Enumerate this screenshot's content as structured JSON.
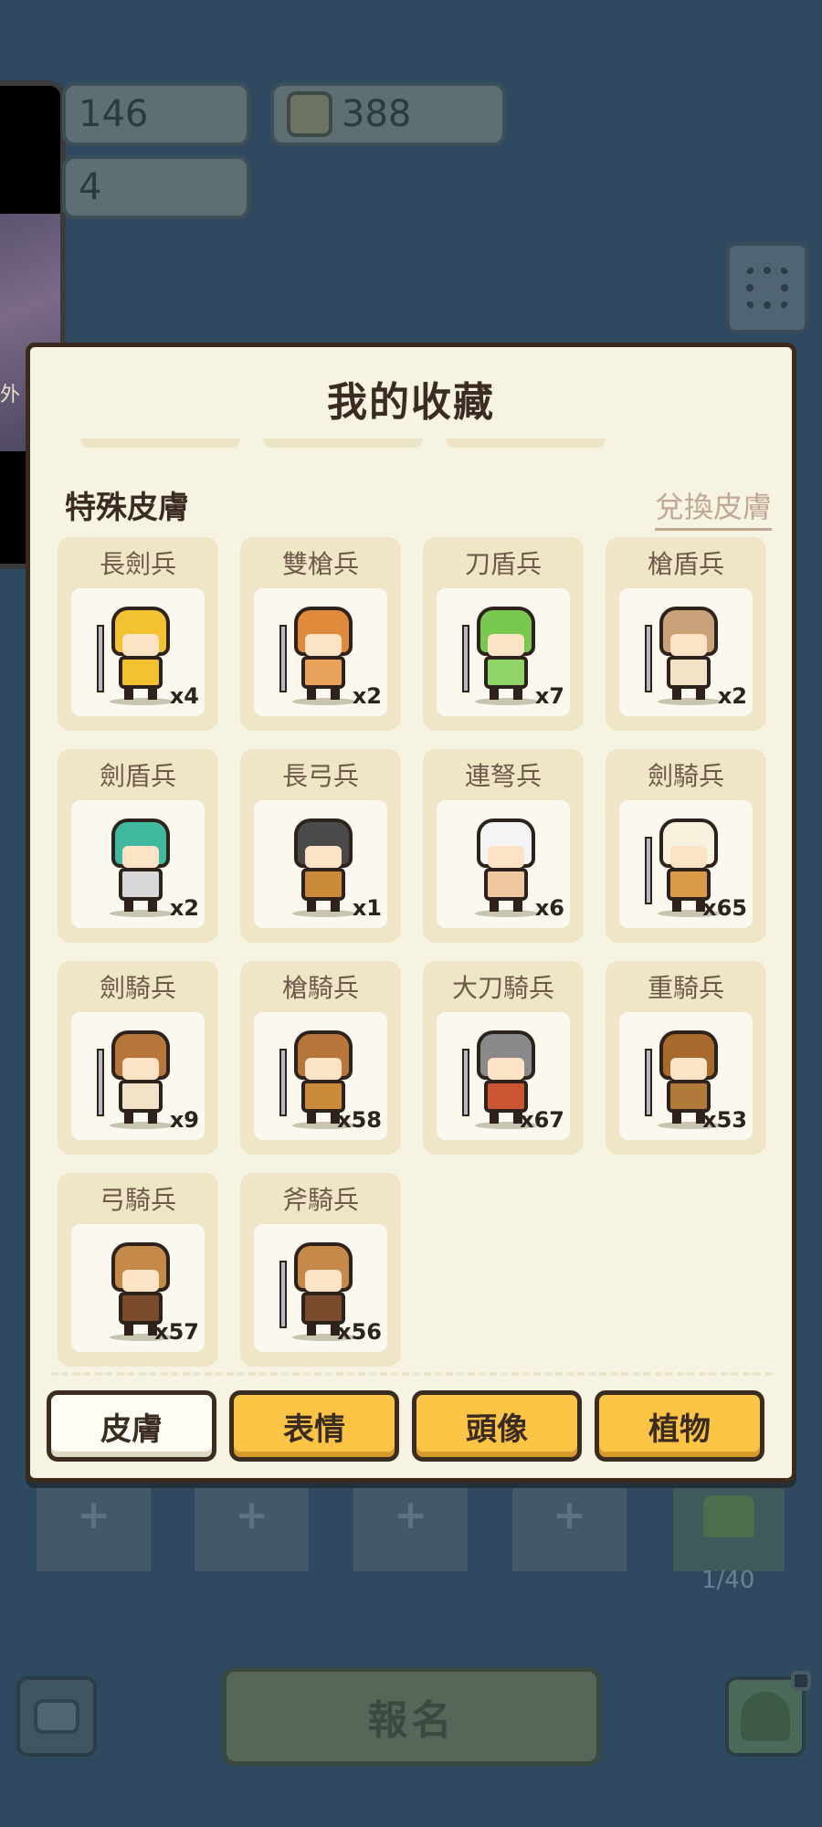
{
  "resources": {
    "gem_value": "146",
    "coin_value": "388",
    "energy_value": "4"
  },
  "video_panel": {
    "caption": "外"
  },
  "background": {
    "slot_plus": "+",
    "player_count": "1/40",
    "signup_label": "報名"
  },
  "modal": {
    "title": "我的收藏",
    "section_title": "特殊皮膚",
    "exchange_label": "兌換皮膚",
    "skins": [
      {
        "name": "長劍兵",
        "count": "x4",
        "head": "#f2c230",
        "body": "#f2c230",
        "weapon": true
      },
      {
        "name": "雙槍兵",
        "count": "x2",
        "head": "#e08a3c",
        "body": "#e9a25a",
        "weapon": true
      },
      {
        "name": "刀盾兵",
        "count": "x7",
        "head": "#78c850",
        "body": "#8fd466",
        "weapon": true
      },
      {
        "name": "槍盾兵",
        "count": "x2",
        "head": "#caa178",
        "body": "#f1e2c8",
        "weapon": true
      },
      {
        "name": "劍盾兵",
        "count": "x2",
        "head": "#3fb8a0",
        "body": "#d8d8d8",
        "weapon": false
      },
      {
        "name": "長弓兵",
        "count": "x1",
        "head": "#4a4a4a",
        "body": "#c98a3a",
        "weapon": false
      },
      {
        "name": "連弩兵",
        "count": "x6",
        "head": "#f4f4f4",
        "body": "#f0c8a0",
        "weapon": false
      },
      {
        "name": "劍騎兵",
        "count": "x65",
        "head": "#f7f2dd",
        "body": "#d99a4a",
        "weapon": true
      },
      {
        "name": "劍騎兵",
        "count": "x9",
        "head": "#b7773c",
        "body": "#f1e2c8",
        "weapon": true
      },
      {
        "name": "槍騎兵",
        "count": "x58",
        "head": "#b7773c",
        "body": "#c98a3a",
        "weapon": true
      },
      {
        "name": "大刀騎兵",
        "count": "x67",
        "head": "#8a8a8a",
        "body": "#cc5533",
        "weapon": true
      },
      {
        "name": "重騎兵",
        "count": "x53",
        "head": "#a86a2c",
        "body": "#b07a3a",
        "weapon": true
      },
      {
        "name": "弓騎兵",
        "count": "x57",
        "head": "#c58a4a",
        "body": "#7a4a2a",
        "weapon": false
      },
      {
        "name": "斧騎兵",
        "count": "x56",
        "head": "#c58a4a",
        "body": "#7a4a2a",
        "weapon": true
      }
    ],
    "tabs": [
      {
        "label": "皮膚",
        "active": true
      },
      {
        "label": "表情",
        "active": false
      },
      {
        "label": "頭像",
        "active": false
      },
      {
        "label": "植物",
        "active": false
      }
    ]
  },
  "colors": {
    "modal_bg": "#f7f3e3",
    "tab_gold": "#fbc444",
    "card_bg": "#efe6c8",
    "text_dark": "#3b2c22"
  }
}
